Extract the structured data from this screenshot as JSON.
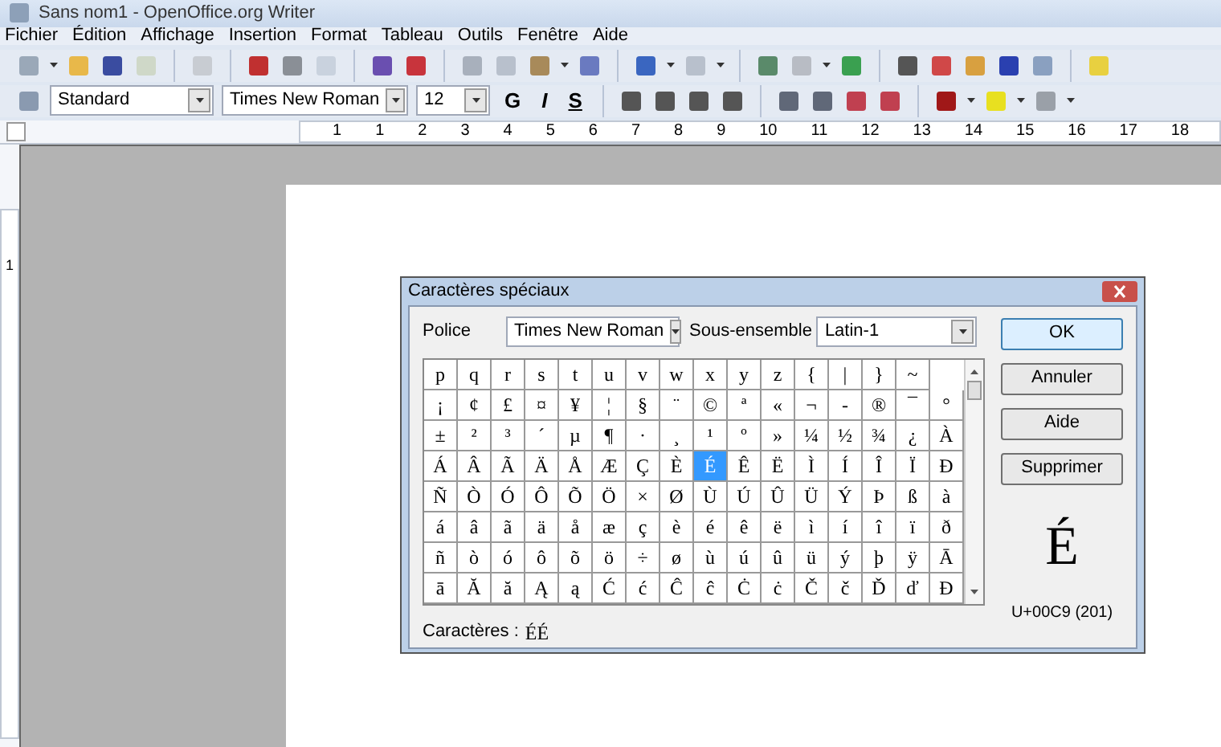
{
  "window": {
    "title": "Sans nom1 - OpenOffice.org Writer"
  },
  "menu": [
    {
      "label": "Fichier"
    },
    {
      "label": "Édition"
    },
    {
      "label": "Affichage"
    },
    {
      "label": "Insertion"
    },
    {
      "label": "Format"
    },
    {
      "label": "Tableau"
    },
    {
      "label": "Outils"
    },
    {
      "label": "Fenêtre"
    },
    {
      "label": "Aide"
    }
  ],
  "format_bar": {
    "style": "Standard",
    "font": "Times New Roman",
    "size": "12",
    "bold": "G",
    "italic": "I",
    "underline": "S"
  },
  "ruler": {
    "labels": [
      "1",
      "1",
      "2",
      "3",
      "4",
      "5",
      "6",
      "7",
      "8",
      "9",
      "10",
      "11",
      "12",
      "13",
      "14",
      "15",
      "16",
      "17",
      "18"
    ],
    "vertical_labels": [
      "1"
    ]
  },
  "dialog": {
    "title": "Caractères spéciaux",
    "font_label": "Police",
    "font_value": "Times New Roman",
    "subset_label": "Sous-ensemble",
    "subset_value": "Latin-1",
    "buttons": [
      {
        "label": "OK",
        "default": true
      },
      {
        "label": "Annuler",
        "default": false
      },
      {
        "label": "Aide",
        "default": false
      },
      {
        "label": "Supprimer",
        "default": false
      }
    ],
    "grid": [
      [
        {
          "char": "p",
          "selected": false
        },
        {
          "char": "q",
          "selected": false
        },
        {
          "char": "r",
          "selected": false
        },
        {
          "char": "s",
          "selected": false
        },
        {
          "char": "t",
          "selected": false
        },
        {
          "char": "u",
          "selected": false
        },
        {
          "char": "v",
          "selected": false
        },
        {
          "char": "w",
          "selected": false
        },
        {
          "char": "x",
          "selected": false
        },
        {
          "char": "y",
          "selected": false
        },
        {
          "char": "z",
          "selected": false
        },
        {
          "char": "{",
          "selected": false
        },
        {
          "char": "|",
          "selected": false
        },
        {
          "char": "}",
          "selected": false
        },
        {
          "char": "~",
          "selected": false
        }
      ],
      [
        {
          "char": "¡",
          "selected": false
        },
        {
          "char": "¢",
          "selected": false
        },
        {
          "char": "£",
          "selected": false
        },
        {
          "char": "¤",
          "selected": false
        },
        {
          "char": "¥",
          "selected": false
        },
        {
          "char": "¦",
          "selected": false
        },
        {
          "char": "§",
          "selected": false
        },
        {
          "char": "¨",
          "selected": false
        },
        {
          "char": "©",
          "selected": false
        },
        {
          "char": "ª",
          "selected": false
        },
        {
          "char": "«",
          "selected": false
        },
        {
          "char": "¬",
          "selected": false
        },
        {
          "char": "-",
          "selected": false
        },
        {
          "char": "®",
          "selected": false
        },
        {
          "char": "¯",
          "selected": false
        },
        {
          "char": "°",
          "selected": false
        }
      ],
      [
        {
          "char": "±",
          "selected": false
        },
        {
          "char": "²",
          "selected": false
        },
        {
          "char": "³",
          "selected": false
        },
        {
          "char": "´",
          "selected": false
        },
        {
          "char": "µ",
          "selected": false
        },
        {
          "char": "¶",
          "selected": false
        },
        {
          "char": "·",
          "selected": false
        },
        {
          "char": "¸",
          "selected": false
        },
        {
          "char": "¹",
          "selected": false
        },
        {
          "char": "º",
          "selected": false
        },
        {
          "char": "»",
          "selected": false
        },
        {
          "char": "¼",
          "selected": false
        },
        {
          "char": "½",
          "selected": false
        },
        {
          "char": "¾",
          "selected": false
        },
        {
          "char": "¿",
          "selected": false
        },
        {
          "char": "À",
          "selected": false
        }
      ],
      [
        {
          "char": "Á",
          "selected": false
        },
        {
          "char": "Â",
          "selected": false
        },
        {
          "char": "Ã",
          "selected": false
        },
        {
          "char": "Ä",
          "selected": false
        },
        {
          "char": "Å",
          "selected": false
        },
        {
          "char": "Æ",
          "selected": false
        },
        {
          "char": "Ç",
          "selected": false
        },
        {
          "char": "È",
          "selected": false
        },
        {
          "char": "É",
          "selected": true
        },
        {
          "char": "Ê",
          "selected": false
        },
        {
          "char": "Ë",
          "selected": false
        },
        {
          "char": "Ì",
          "selected": false
        },
        {
          "char": "Í",
          "selected": false
        },
        {
          "char": "Î",
          "selected": false
        },
        {
          "char": "Ï",
          "selected": false
        },
        {
          "char": "Ð",
          "selected": false
        }
      ],
      [
        {
          "char": "Ñ",
          "selected": false
        },
        {
          "char": "Ò",
          "selected": false
        },
        {
          "char": "Ó",
          "selected": false
        },
        {
          "char": "Ô",
          "selected": false
        },
        {
          "char": "Õ",
          "selected": false
        },
        {
          "char": "Ö",
          "selected": false
        },
        {
          "char": "×",
          "selected": false
        },
        {
          "char": "Ø",
          "selected": false
        },
        {
          "char": "Ù",
          "selected": false
        },
        {
          "char": "Ú",
          "selected": false
        },
        {
          "char": "Û",
          "selected": false
        },
        {
          "char": "Ü",
          "selected": false
        },
        {
          "char": "Ý",
          "selected": false
        },
        {
          "char": "Þ",
          "selected": false
        },
        {
          "char": "ß",
          "selected": false
        },
        {
          "char": "à",
          "selected": false
        }
      ],
      [
        {
          "char": "á",
          "selected": false
        },
        {
          "char": "â",
          "selected": false
        },
        {
          "char": "ã",
          "selected": false
        },
        {
          "char": "ä",
          "selected": false
        },
        {
          "char": "å",
          "selected": false
        },
        {
          "char": "æ",
          "selected": false
        },
        {
          "char": "ç",
          "selected": false
        },
        {
          "char": "è",
          "selected": false
        },
        {
          "char": "é",
          "selected": false
        },
        {
          "char": "ê",
          "selected": false
        },
        {
          "char": "ë",
          "selected": false
        },
        {
          "char": "ì",
          "selected": false
        },
        {
          "char": "í",
          "selected": false
        },
        {
          "char": "î",
          "selected": false
        },
        {
          "char": "ï",
          "selected": false
        },
        {
          "char": "ð",
          "selected": false
        }
      ],
      [
        {
          "char": "ñ",
          "selected": false
        },
        {
          "char": "ò",
          "selected": false
        },
        {
          "char": "ó",
          "selected": false
        },
        {
          "char": "ô",
          "selected": false
        },
        {
          "char": "õ",
          "selected": false
        },
        {
          "char": "ö",
          "selected": false
        },
        {
          "char": "÷",
          "selected": false
        },
        {
          "char": "ø",
          "selected": false
        },
        {
          "char": "ù",
          "selected": false
        },
        {
          "char": "ú",
          "selected": false
        },
        {
          "char": "û",
          "selected": false
        },
        {
          "char": "ü",
          "selected": false
        },
        {
          "char": "ý",
          "selected": false
        },
        {
          "char": "þ",
          "selected": false
        },
        {
          "char": "ÿ",
          "selected": false
        },
        {
          "char": "Ā",
          "selected": false
        }
      ],
      [
        {
          "char": "ā",
          "selected": false
        },
        {
          "char": "Ă",
          "selected": false
        },
        {
          "char": "ă",
          "selected": false
        },
        {
          "char": "Ą",
          "selected": false
        },
        {
          "char": "ą",
          "selected": false
        },
        {
          "char": "Ć",
          "selected": false
        },
        {
          "char": "ć",
          "selected": false
        },
        {
          "char": "Ĉ",
          "selected": false
        },
        {
          "char": "ĉ",
          "selected": false
        },
        {
          "char": "Ċ",
          "selected": false
        },
        {
          "char": "ċ",
          "selected": false
        },
        {
          "char": "Č",
          "selected": false
        },
        {
          "char": "č",
          "selected": false
        },
        {
          "char": "Ď",
          "selected": false
        },
        {
          "char": "ď",
          "selected": false
        },
        {
          "char": "Đ",
          "selected": false
        }
      ]
    ],
    "preview": "É",
    "code": "U+00C9 (201)",
    "chars_label": "Caractères :",
    "chars_value": "ÉÉ"
  }
}
